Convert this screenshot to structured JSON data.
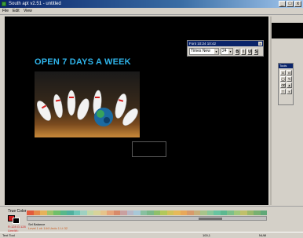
{
  "window": {
    "title": "South apt v2.51 - untitled",
    "min_glyph": "_",
    "max_glyph": "□",
    "close_glyph": "x"
  },
  "menu": {
    "items": [
      "File",
      "Edit",
      "View"
    ]
  },
  "canvas": {
    "headline": "OPEN 7 DAYS A WEEK"
  },
  "font_panel": {
    "title": "Font  10:24  10:42",
    "font_name": "Times New",
    "font_size": "24",
    "dropdown_glyph": "▾",
    "style_buttons": [
      "B",
      "I",
      "U",
      "S"
    ],
    "close_glyph": "x"
  },
  "tools_panel": {
    "title": "Tools",
    "tools": [
      "A",
      "▭",
      "◯",
      "✎",
      "⌫",
      "▲",
      "T",
      "◐"
    ]
  },
  "colors": {
    "label": "True Color",
    "fg": "#cc1c1c",
    "bg": "#000000",
    "palette": [
      "#e25a3c",
      "#e68a4a",
      "#e6b25a",
      "#9ec46a",
      "#6fbf6a",
      "#58b88a",
      "#4fb09e",
      "#6fc7b8",
      "#9fd1c2",
      "#c4d8a8",
      "#d8d49a",
      "#e6c48a",
      "#e6a47a",
      "#d88a6a",
      "#c9a0a0",
      "#b8b8c8",
      "#a8c8d8",
      "#88c0a0",
      "#7ab88a",
      "#8ec06a",
      "#b2c85a",
      "#d2c25a",
      "#e6ba5a",
      "#e8a85a",
      "#d89a6a",
      "#c8b07a",
      "#a8c48a",
      "#88c89a",
      "#68c4a0",
      "#5cb890",
      "#7cc08a",
      "#a0c87a",
      "#c0c06a",
      "#9ab86a",
      "#78b070",
      "#60a878"
    ]
  },
  "bottom": {
    "coord_a": "R:128 G:128",
    "coord_b": "Line(#):",
    "info_label": "Sel Balance",
    "info_values": "Level 1 ch 144    Undo 1 Lt 32"
  },
  "status": {
    "left": "Text Tool",
    "mid": "100,1",
    "right": "NUM"
  }
}
